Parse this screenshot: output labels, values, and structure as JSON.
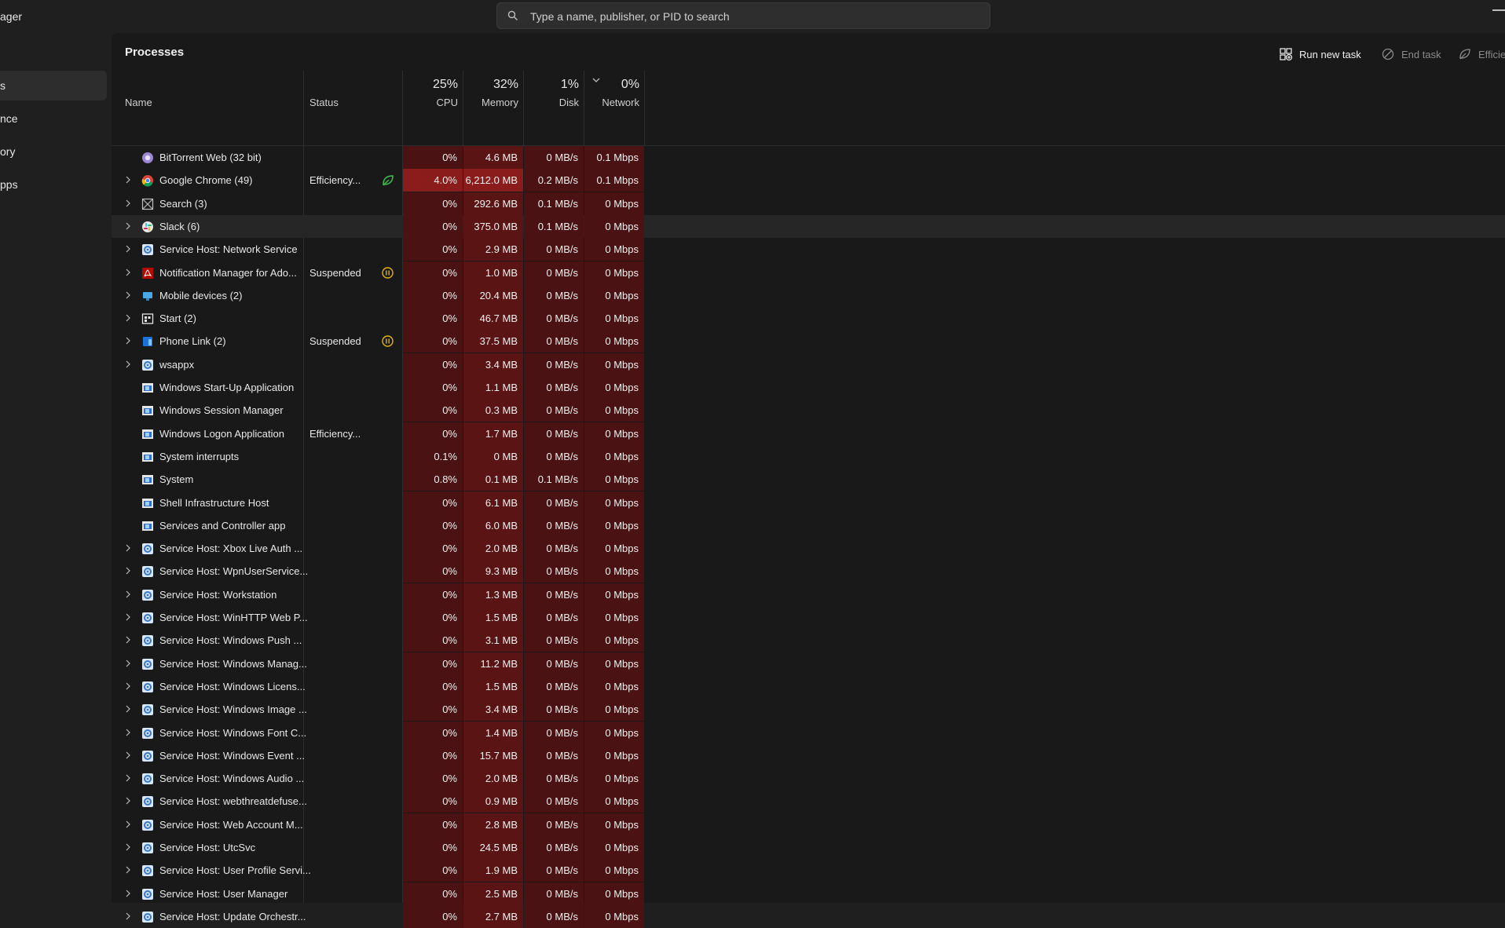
{
  "app": {
    "title": "ager"
  },
  "search": {
    "placeholder": "Type a name, publisher, or PID to search"
  },
  "sidebar": {
    "items": [
      {
        "label": "s",
        "active": true
      },
      {
        "label": "nce",
        "active": false
      },
      {
        "label": "ory",
        "active": false
      },
      {
        "label": "pps",
        "active": false
      }
    ]
  },
  "page": {
    "title": "Processes"
  },
  "toolbar": {
    "run_new_task": "Run new task",
    "end_task": "End task",
    "efficiency": "Efficie"
  },
  "columns": {
    "name": "Name",
    "status": "Status",
    "cpu": {
      "pct": "25%",
      "label": "CPU"
    },
    "memory": {
      "pct": "32%",
      "label": "Memory"
    },
    "disk": {
      "pct": "1%",
      "label": "Disk"
    },
    "network": {
      "pct": "0%",
      "label": "Network"
    }
  },
  "colors": {
    "heat_base": "#4a1212",
    "heat_mid": "#5a1414",
    "heat_high": "#8a1c1c",
    "accent_green": "#3fbf50",
    "accent_yellow": "#e8b20a"
  },
  "processes": [
    {
      "name": "BitTorrent Web (32 bit)",
      "expand": false,
      "icon": "bittorrent-icon",
      "status": "",
      "status_icon": "",
      "cpu": "0%",
      "memory": "4.6 MB",
      "disk": "0 MB/s",
      "network": "0.1 Mbps"
    },
    {
      "name": "Google Chrome (49)",
      "expand": true,
      "icon": "chrome-icon",
      "status": "Efficiency...",
      "status_icon": "efficiency-leaf-icon",
      "cpu": "4.0%",
      "memory": "6,212.0 MB",
      "disk": "0.2 MB/s",
      "network": "0.1 Mbps",
      "hot_cpu": true,
      "hot_mem": true
    },
    {
      "name": "Search (3)",
      "expand": true,
      "icon": "search-app-icon",
      "status": "",
      "status_icon": "",
      "cpu": "0%",
      "memory": "292.6 MB",
      "disk": "0.1 MB/s",
      "network": "0 Mbps"
    },
    {
      "name": "Slack (6)",
      "expand": true,
      "icon": "slack-icon",
      "status": "",
      "status_icon": "",
      "cpu": "0%",
      "memory": "375.0 MB",
      "disk": "0.1 MB/s",
      "network": "0 Mbps",
      "hover": true
    },
    {
      "name": "Service Host: Network Service",
      "expand": true,
      "icon": "gear-service-icon",
      "status": "",
      "status_icon": "",
      "cpu": "0%",
      "memory": "2.9 MB",
      "disk": "0 MB/s",
      "network": "0 Mbps"
    },
    {
      "name": "Notification Manager for Ado...",
      "expand": true,
      "icon": "acrobat-icon",
      "status": "Suspended",
      "status_icon": "suspended-icon",
      "cpu": "0%",
      "memory": "1.0 MB",
      "disk": "0 MB/s",
      "network": "0 Mbps"
    },
    {
      "name": "Mobile devices (2)",
      "expand": true,
      "icon": "mobile-devices-icon",
      "status": "",
      "status_icon": "",
      "cpu": "0%",
      "memory": "20.4 MB",
      "disk": "0 MB/s",
      "network": "0 Mbps"
    },
    {
      "name": "Start (2)",
      "expand": true,
      "icon": "start-icon",
      "status": "",
      "status_icon": "",
      "cpu": "0%",
      "memory": "46.7 MB",
      "disk": "0 MB/s",
      "network": "0 Mbps"
    },
    {
      "name": "Phone Link (2)",
      "expand": true,
      "icon": "phone-link-icon",
      "status": "Suspended",
      "status_icon": "suspended-icon",
      "cpu": "0%",
      "memory": "37.5 MB",
      "disk": "0 MB/s",
      "network": "0 Mbps"
    },
    {
      "name": "wsappx",
      "expand": true,
      "icon": "gear-service-icon",
      "status": "",
      "status_icon": "",
      "cpu": "0%",
      "memory": "3.4 MB",
      "disk": "0 MB/s",
      "network": "0 Mbps"
    },
    {
      "name": "Windows Start-Up Application",
      "expand": false,
      "icon": "window-app-icon",
      "status": "",
      "status_icon": "",
      "cpu": "0%",
      "memory": "1.1 MB",
      "disk": "0 MB/s",
      "network": "0 Mbps"
    },
    {
      "name": "Windows Session Manager",
      "expand": false,
      "icon": "window-app-icon",
      "status": "",
      "status_icon": "",
      "cpu": "0%",
      "memory": "0.3 MB",
      "disk": "0 MB/s",
      "network": "0 Mbps"
    },
    {
      "name": "Windows Logon Application",
      "expand": false,
      "icon": "window-app-icon",
      "status": "Efficiency...",
      "status_icon": "",
      "cpu": "0%",
      "memory": "1.7 MB",
      "disk": "0 MB/s",
      "network": "0 Mbps"
    },
    {
      "name": "System interrupts",
      "expand": false,
      "icon": "window-app-icon",
      "status": "",
      "status_icon": "",
      "cpu": "0.1%",
      "memory": "0 MB",
      "disk": "0 MB/s",
      "network": "0 Mbps"
    },
    {
      "name": "System",
      "expand": false,
      "icon": "window-app-icon",
      "status": "",
      "status_icon": "",
      "cpu": "0.8%",
      "memory": "0.1 MB",
      "disk": "0.1 MB/s",
      "network": "0 Mbps"
    },
    {
      "name": "Shell Infrastructure Host",
      "expand": false,
      "icon": "window-app-icon",
      "status": "",
      "status_icon": "",
      "cpu": "0%",
      "memory": "6.1 MB",
      "disk": "0 MB/s",
      "network": "0 Mbps"
    },
    {
      "name": "Services and Controller app",
      "expand": false,
      "icon": "window-app-icon",
      "status": "",
      "status_icon": "",
      "cpu": "0%",
      "memory": "6.0 MB",
      "disk": "0 MB/s",
      "network": "0 Mbps"
    },
    {
      "name": "Service Host: Xbox Live Auth ...",
      "expand": true,
      "icon": "gear-service-icon",
      "status": "",
      "status_icon": "",
      "cpu": "0%",
      "memory": "2.0 MB",
      "disk": "0 MB/s",
      "network": "0 Mbps"
    },
    {
      "name": "Service Host: WpnUserService...",
      "expand": true,
      "icon": "gear-service-icon",
      "status": "",
      "status_icon": "",
      "cpu": "0%",
      "memory": "9.3 MB",
      "disk": "0 MB/s",
      "network": "0 Mbps"
    },
    {
      "name": "Service Host: Workstation",
      "expand": true,
      "icon": "gear-service-icon",
      "status": "",
      "status_icon": "",
      "cpu": "0%",
      "memory": "1.3 MB",
      "disk": "0 MB/s",
      "network": "0 Mbps"
    },
    {
      "name": "Service Host: WinHTTP Web P...",
      "expand": true,
      "icon": "gear-service-icon",
      "status": "",
      "status_icon": "",
      "cpu": "0%",
      "memory": "1.5 MB",
      "disk": "0 MB/s",
      "network": "0 Mbps"
    },
    {
      "name": "Service Host: Windows Push ...",
      "expand": true,
      "icon": "gear-service-icon",
      "status": "",
      "status_icon": "",
      "cpu": "0%",
      "memory": "3.1 MB",
      "disk": "0 MB/s",
      "network": "0 Mbps"
    },
    {
      "name": "Service Host: Windows Manag...",
      "expand": true,
      "icon": "gear-service-icon",
      "status": "",
      "status_icon": "",
      "cpu": "0%",
      "memory": "11.2 MB",
      "disk": "0 MB/s",
      "network": "0 Mbps"
    },
    {
      "name": "Service Host: Windows Licens...",
      "expand": true,
      "icon": "gear-service-icon",
      "status": "",
      "status_icon": "",
      "cpu": "0%",
      "memory": "1.5 MB",
      "disk": "0 MB/s",
      "network": "0 Mbps"
    },
    {
      "name": "Service Host: Windows Image ...",
      "expand": true,
      "icon": "gear-service-icon",
      "status": "",
      "status_icon": "",
      "cpu": "0%",
      "memory": "3.4 MB",
      "disk": "0 MB/s",
      "network": "0 Mbps"
    },
    {
      "name": "Service Host: Windows Font C...",
      "expand": true,
      "icon": "gear-service-icon",
      "status": "",
      "status_icon": "",
      "cpu": "0%",
      "memory": "1.4 MB",
      "disk": "0 MB/s",
      "network": "0 Mbps"
    },
    {
      "name": "Service Host: Windows Event ...",
      "expand": true,
      "icon": "gear-service-icon",
      "status": "",
      "status_icon": "",
      "cpu": "0%",
      "memory": "15.7 MB",
      "disk": "0 MB/s",
      "network": "0 Mbps"
    },
    {
      "name": "Service Host: Windows Audio ...",
      "expand": true,
      "icon": "gear-service-icon",
      "status": "",
      "status_icon": "",
      "cpu": "0%",
      "memory": "2.0 MB",
      "disk": "0 MB/s",
      "network": "0 Mbps"
    },
    {
      "name": "Service Host: webthreatdefuse...",
      "expand": true,
      "icon": "gear-service-icon",
      "status": "",
      "status_icon": "",
      "cpu": "0%",
      "memory": "0.9 MB",
      "disk": "0 MB/s",
      "network": "0 Mbps"
    },
    {
      "name": "Service Host: Web Account M...",
      "expand": true,
      "icon": "gear-service-icon",
      "status": "",
      "status_icon": "",
      "cpu": "0%",
      "memory": "2.8 MB",
      "disk": "0 MB/s",
      "network": "0 Mbps"
    },
    {
      "name": "Service Host: UtcSvc",
      "expand": true,
      "icon": "gear-service-icon",
      "status": "",
      "status_icon": "",
      "cpu": "0%",
      "memory": "24.5 MB",
      "disk": "0 MB/s",
      "network": "0 Mbps"
    },
    {
      "name": "Service Host: User Profile Servi...",
      "expand": true,
      "icon": "gear-service-icon",
      "status": "",
      "status_icon": "",
      "cpu": "0%",
      "memory": "1.9 MB",
      "disk": "0 MB/s",
      "network": "0 Mbps"
    },
    {
      "name": "Service Host: User Manager",
      "expand": true,
      "icon": "gear-service-icon",
      "status": "",
      "status_icon": "",
      "cpu": "0%",
      "memory": "2.5 MB",
      "disk": "0 MB/s",
      "network": "0 Mbps"
    },
    {
      "name": "Service Host: Update Orchestr...",
      "expand": true,
      "icon": "gear-service-icon",
      "status": "",
      "status_icon": "",
      "cpu": "0%",
      "memory": "2.7 MB",
      "disk": "0 MB/s",
      "network": "0 Mbps"
    }
  ]
}
